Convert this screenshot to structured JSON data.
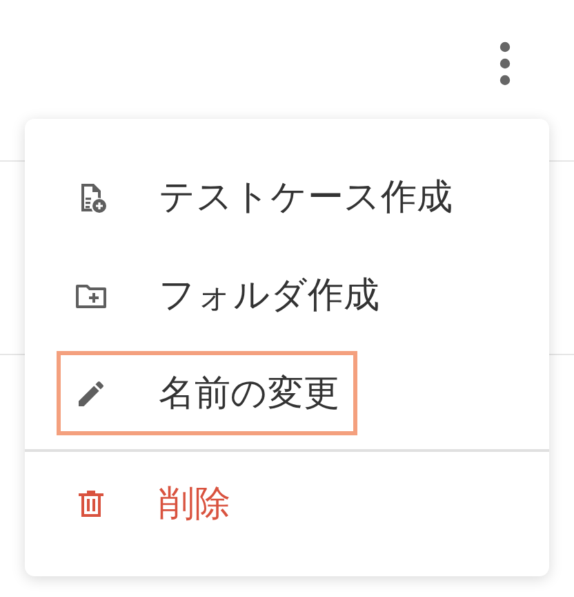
{
  "menu": {
    "items": [
      {
        "label": "テストケース作成",
        "kind": "new-test-case",
        "highlighted": false,
        "danger": false,
        "divider_before": false
      },
      {
        "label": "フォルダ作成",
        "kind": "new-folder",
        "highlighted": false,
        "danger": false,
        "divider_before": false
      },
      {
        "label": "名前の変更",
        "kind": "rename",
        "highlighted": true,
        "danger": false,
        "divider_before": false
      },
      {
        "label": "削除",
        "kind": "delete",
        "highlighted": false,
        "danger": true,
        "divider_before": true
      }
    ]
  }
}
